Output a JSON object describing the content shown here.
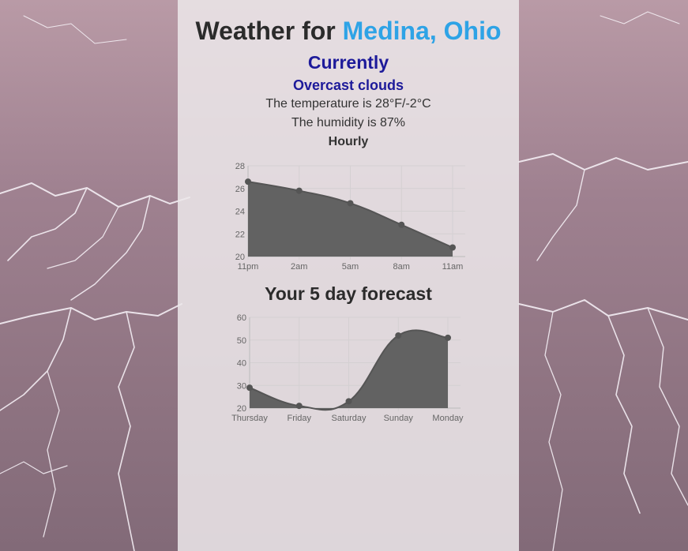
{
  "header": {
    "prefix": "Weather for ",
    "city": "Medina, Ohio"
  },
  "current": {
    "heading": "Currently",
    "condition": "Overcast clouds",
    "temperature": "The temperature is 28°F/-2°C",
    "humidity": "The humidity is 87%"
  },
  "hourly": {
    "heading": "Hourly"
  },
  "forecast": {
    "heading": "Your 5 day forecast"
  },
  "colors": {
    "accent": "#2ea3e6",
    "heading": "#1d1a9a",
    "area_fill": "#626262"
  },
  "chart_data": [
    {
      "type": "area",
      "categories": [
        "11pm",
        "2am",
        "5am",
        "8am",
        "11am"
      ],
      "series": [
        {
          "values": [
            26.6,
            25.8,
            24.7,
            22.8,
            20.8
          ]
        }
      ],
      "ylim": [
        20,
        28
      ],
      "yticks": [
        20,
        22,
        24,
        26,
        28
      ],
      "grid": true
    },
    {
      "type": "area",
      "categories": [
        "Thursday",
        "Friday",
        "Saturday",
        "Sunday",
        "Monday"
      ],
      "series": [
        {
          "values": [
            29,
            21,
            23,
            52,
            51
          ]
        }
      ],
      "ylim": [
        20,
        60
      ],
      "yticks": [
        20,
        30,
        40,
        50,
        60
      ],
      "grid": true
    }
  ]
}
